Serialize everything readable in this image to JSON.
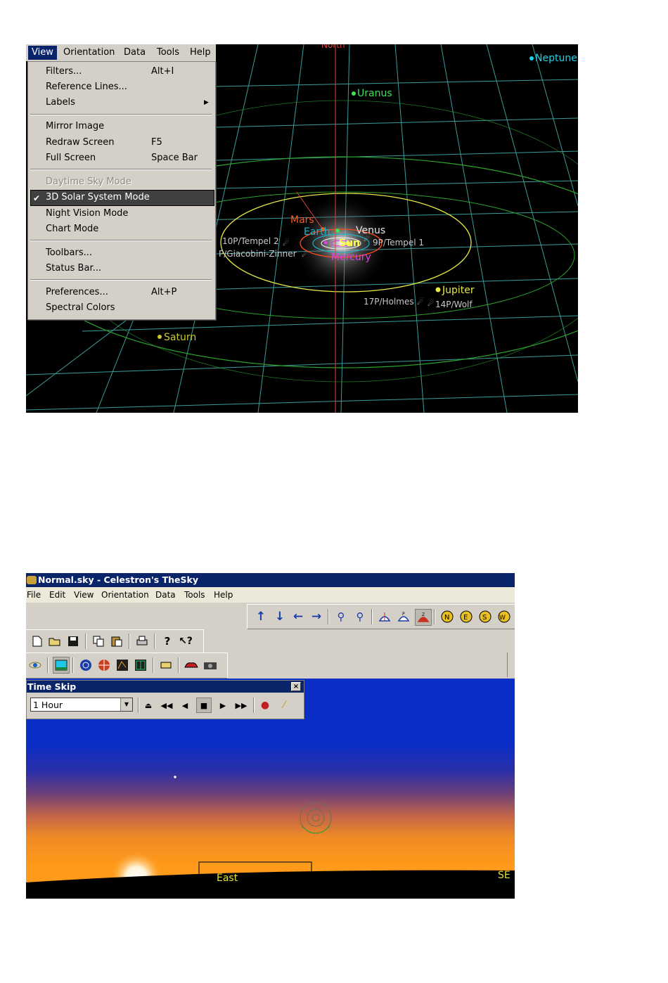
{
  "view_menu_screenshot": {
    "menubar": {
      "items": [
        "View",
        "Orientation",
        "Data",
        "Tools",
        "Help"
      ]
    },
    "view_menu": {
      "items": [
        {
          "label": "Filters...",
          "shortcut": "Alt+I"
        },
        {
          "label": "Reference Lines...",
          "shortcut": ""
        },
        {
          "label": "Labels",
          "shortcut": "",
          "submenu": true
        },
        {
          "label": "Mirror Image",
          "shortcut": ""
        },
        {
          "label": "Redraw Screen",
          "shortcut": "F5"
        },
        {
          "label": "Full Screen",
          "shortcut": "Space Bar"
        },
        {
          "label": "Daytime Sky Mode",
          "shortcut": "",
          "disabled": true
        },
        {
          "label": "3D Solar System Mode",
          "shortcut": "",
          "checked": true,
          "highlighted": true
        },
        {
          "label": "Night Vision Mode",
          "shortcut": ""
        },
        {
          "label": "Chart Mode",
          "shortcut": ""
        },
        {
          "label": "Toolbars...",
          "shortcut": ""
        },
        {
          "label": "Status Bar...",
          "shortcut": ""
        },
        {
          "label": "Preferences...",
          "shortcut": "Alt+P"
        },
        {
          "label": "Spectral Colors",
          "shortcut": ""
        }
      ]
    },
    "space_labels": {
      "north": "North",
      "neptune": "Neptune",
      "uranus": "Uranus",
      "mars": "Mars",
      "earth": "Earth",
      "venus": "Venus",
      "sun": "Sun",
      "mercury": "Mercury",
      "tempel2": "10P/Tempel 2",
      "tempel1": "9P/Tempel 1",
      "giacobini": "P/Giacobini-Zinner",
      "jupiter": "Jupiter",
      "holmes": "17P/Holmes",
      "wolf": "14P/Wolf",
      "saturn": "Saturn"
    },
    "colors": {
      "grid": "#3a9c9a",
      "orbit_yellow": "#e8e84a",
      "orbit_green": "#2da32d",
      "north_line": "#e0433a",
      "neptune": "#18d4e8",
      "uranus": "#3ee05a",
      "mars": "#ff5a1e",
      "mercury": "#e040e0",
      "comet": "#c8c8c8",
      "saturn": "#c8c832"
    }
  },
  "thesky_screenshot": {
    "window_title": "Normal.sky - Celestron's TheSky",
    "menubar": [
      "File",
      "Edit",
      "View",
      "Orientation",
      "Data",
      "Tools",
      "Help"
    ],
    "time_skip": {
      "title": "Time Skip",
      "close_glyph": "×",
      "interval_value": "1 Hour"
    },
    "horizon_labels": {
      "east": "East",
      "southeast": "SE"
    },
    "colors": {
      "titlebar": "#0a246a",
      "sky_top": "#0a2ec6",
      "horizon_orange": "#ff9a1a"
    }
  }
}
